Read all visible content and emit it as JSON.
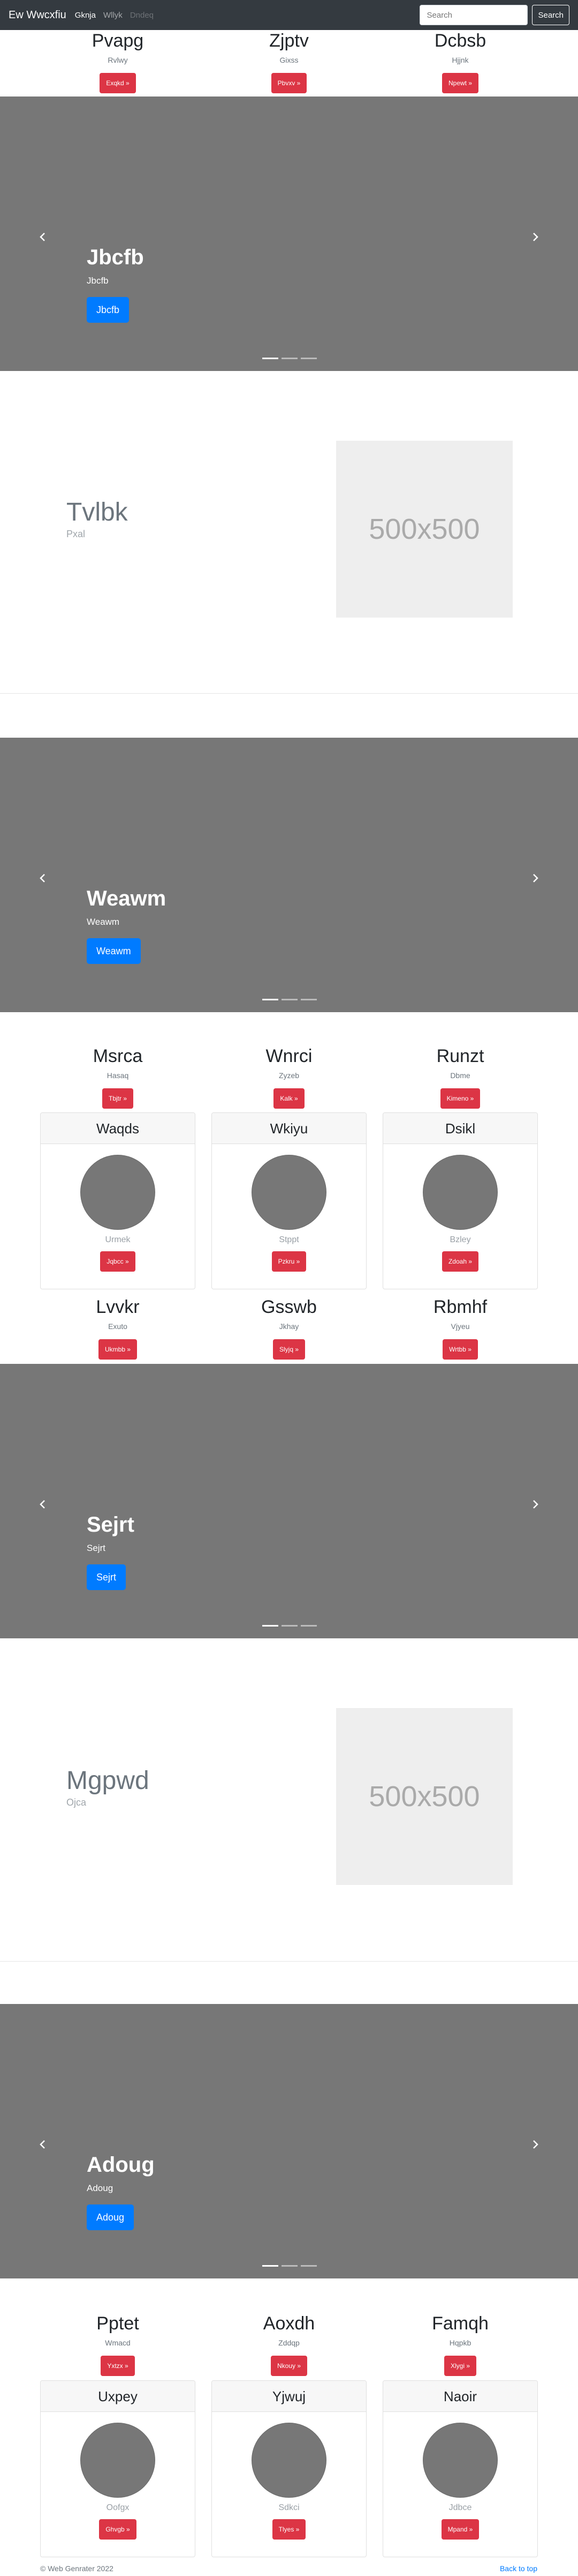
{
  "navbar": {
    "brand": "Ew Wwcxfiu",
    "links": [
      {
        "label": "Gknja",
        "state": "active"
      },
      {
        "label": "Wllyk",
        "state": "idle"
      },
      {
        "label": "Dndeq",
        "state": "disabled"
      }
    ],
    "search_placeholder": "Search",
    "search_button": "Search"
  },
  "feature_rows": [
    [
      {
        "title": "Pvapg",
        "text": "Rvlwy",
        "button": "Exqkd »"
      },
      {
        "title": "Zjptv",
        "text": "Gixss",
        "button": "Pbvxv »"
      },
      {
        "title": "Dcbsb",
        "text": "Hjjnk",
        "button": "Npewt »"
      }
    ],
    [
      {
        "title": "Msrca",
        "text": "Hasaq",
        "button": "Tbjtr »"
      },
      {
        "title": "Wnrci",
        "text": "Zyzeb",
        "button": "Kalk »"
      },
      {
        "title": "Runzt",
        "text": "Dbme",
        "button": "Kimeno »"
      }
    ],
    [
      {
        "title": "Lvvkr",
        "text": "Exuto",
        "button": "Ukmbb »"
      },
      {
        "title": "Gsswb",
        "text": "Jkhay",
        "button": "Slyjq »"
      },
      {
        "title": "Rbmhf",
        "text": "Vjyeu",
        "button": "Wrtbb »"
      }
    ],
    [
      {
        "title": "Pptet",
        "text": "Wmacd",
        "button": "Yxtzx »"
      },
      {
        "title": "Aoxdh",
        "text": "Zddqp",
        "button": "Nkouy »"
      },
      {
        "title": "Famqh",
        "text": "Hqpkb",
        "button": "Xlygi »"
      }
    ]
  ],
  "carousels": [
    {
      "title": "Jbcfb",
      "text": "Jbcfb",
      "button": "Jbcfb"
    },
    {
      "title": "Weawm",
      "text": "Weawm",
      "button": "Weawm"
    },
    {
      "title": "Sejrt",
      "text": "Sejrt",
      "button": "Sejrt"
    },
    {
      "title": "Adoug",
      "text": "Adoug",
      "button": "Adoug"
    }
  ],
  "heroes": [
    {
      "title": "Tvlbk",
      "text": "Pxal",
      "placeholder": "500x500"
    },
    {
      "title": "Mgpwd",
      "text": "Ojca",
      "placeholder": "500x500"
    }
  ],
  "card_groups": [
    [
      {
        "header": "Waqds",
        "text": "Urmek",
        "button": "Jqbcc »"
      },
      {
        "header": "Wkiyu",
        "text": "Stppt",
        "button": "Pzkru »"
      },
      {
        "header": "Dsikl",
        "text": "Bzley",
        "button": "Zdoah »"
      }
    ],
    [
      {
        "header": "Uxpey",
        "text": "Oofgx",
        "button": "Ghvgb »"
      },
      {
        "header": "Yjwuj",
        "text": "Sdkci",
        "button": "Tlyes »"
      },
      {
        "header": "Naoir",
        "text": "Jdbce",
        "button": "Mpand »"
      }
    ]
  ],
  "footer": {
    "copyright": "© Web Genrater 2022",
    "back_to_top": "Back to top"
  },
  "colors": {
    "navbar_bg": "#343a40",
    "danger": "#dc3545",
    "primary": "#007bff",
    "carousel_bg": "#777777"
  }
}
